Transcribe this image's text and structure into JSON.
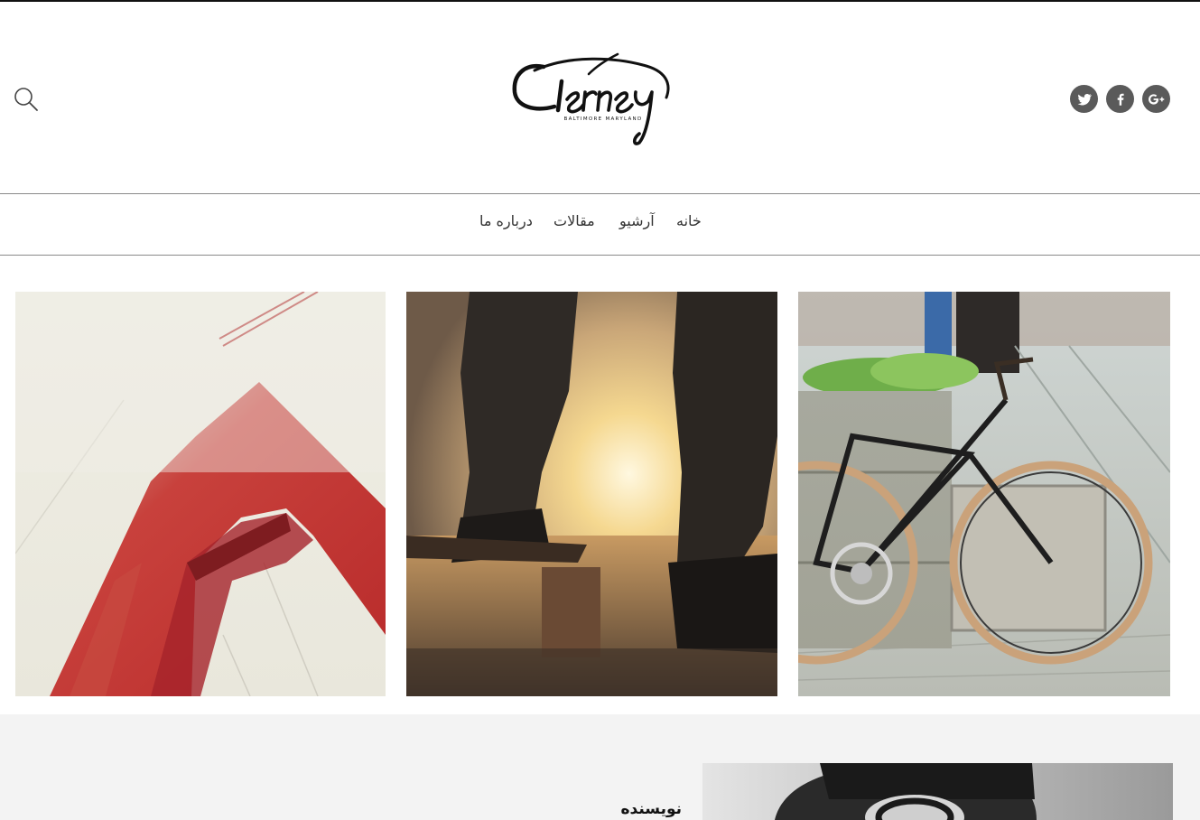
{
  "header": {
    "logo": {
      "wordmark": "Tierney",
      "tagline": "BALTIMORE MARYLAND"
    },
    "search_icon": "search-icon",
    "social": [
      {
        "name": "twitter",
        "icon": "twitter-icon"
      },
      {
        "name": "facebook",
        "icon": "facebook-icon"
      },
      {
        "name": "google-plus",
        "icon": "google-plus-icon"
      }
    ]
  },
  "nav": {
    "items": [
      {
        "label": "خانه"
      },
      {
        "label": "آرشیو"
      },
      {
        "label": "مقالات"
      },
      {
        "label": "درباره ما"
      }
    ]
  },
  "gallery": [
    {
      "subject": "red bridge tower in fog"
    },
    {
      "subject": "skateboarder at sunset"
    },
    {
      "subject": "bicycle beside barrel planter"
    }
  ],
  "author": {
    "heading": "نویسنده"
  },
  "colors": {
    "social_icon_bg": "#5a5a5a",
    "author_band_bg": "#f3f3f3",
    "rule": "#8a8a8a"
  }
}
